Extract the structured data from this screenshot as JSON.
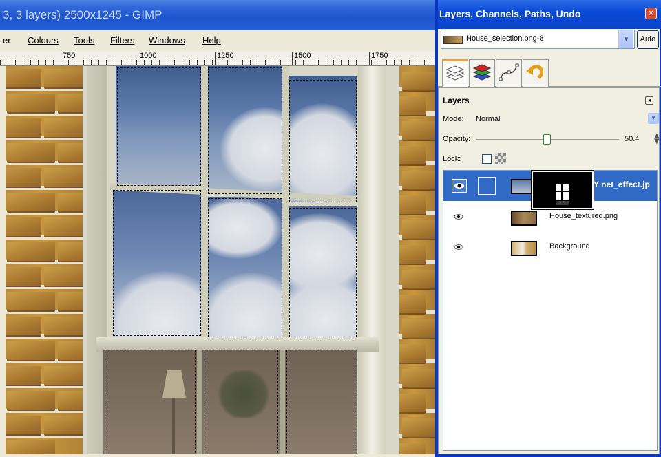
{
  "image_window": {
    "title": "3, 3 layers) 2500x1245 - GIMP",
    "menu": [
      "er",
      "Colours",
      "Tools",
      "Filters",
      "Windows",
      "Help"
    ],
    "ruler_labels": [
      "750",
      "1000",
      "1250",
      "1500",
      "1750"
    ]
  },
  "dock": {
    "title": "Layers, Channels, Paths, Undo",
    "close_glyph": "✕",
    "image_selector": "House_selection.png-8",
    "dropdown_glyph": "▾",
    "auto_label": "Auto",
    "tabs": [
      {
        "icon": "layers-icon"
      },
      {
        "icon": "channels-icon"
      },
      {
        "icon": "paths-icon"
      },
      {
        "icon": "undo-icon"
      }
    ],
    "panel": {
      "title": "Layers",
      "mode_label": "Mode:",
      "mode_value": "Normal",
      "opacity_label": "Opacity:",
      "opacity_value": "50.4",
      "opacity_fraction": 0.504,
      "lock_label": "Lock:",
      "layers": [
        {
          "name": "Y net_effect.jp",
          "selected": true,
          "visible": true
        },
        {
          "name": "House_textured.png",
          "selected": false,
          "visible": true
        },
        {
          "name": "Background",
          "selected": false,
          "visible": true
        }
      ]
    }
  },
  "colors": {
    "titlebar_blue": "#0a44cc",
    "selection_blue": "#316ac5",
    "panel_bg": "#f1efe2"
  }
}
